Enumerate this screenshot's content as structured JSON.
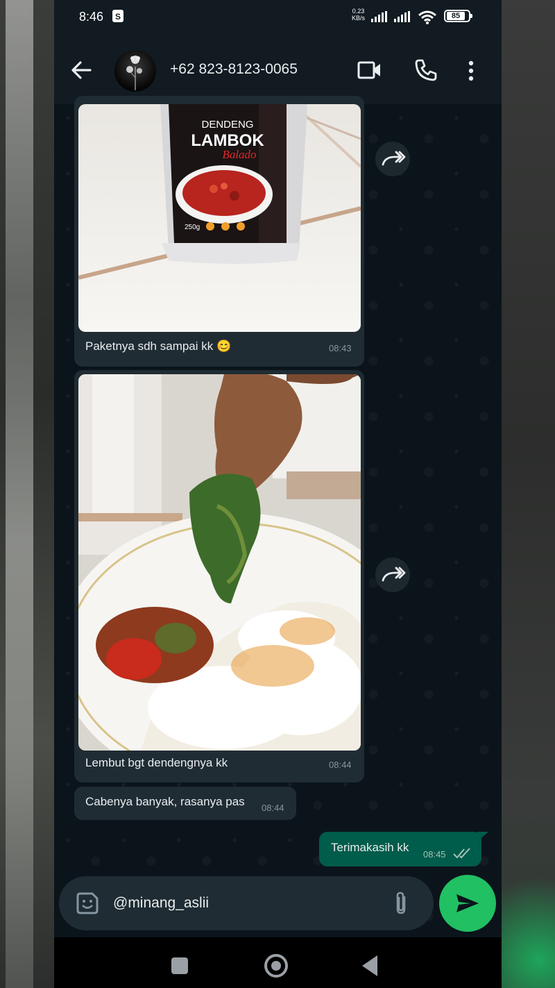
{
  "status_bar": {
    "time": "8:46",
    "net_speed_value": "0.23",
    "net_speed_unit": "KB/s",
    "battery": "85"
  },
  "header": {
    "contact": "+62 823-8123-0065",
    "icons": [
      "back-arrow-icon",
      "video-call-icon",
      "phone-icon",
      "more-icon"
    ]
  },
  "messages": [
    {
      "type": "image",
      "direction": "incoming",
      "package_brand_top": "DENDENG",
      "package_brand_main": "LAMBOK",
      "package_brand_sub": "Balado",
      "package_weight": "250g",
      "caption": "Paketnya sdh sampai kk 😊",
      "time": "08:43"
    },
    {
      "type": "image",
      "direction": "incoming",
      "caption": "Lembut bgt dendengnya kk",
      "time": "08:44"
    },
    {
      "type": "text",
      "direction": "incoming",
      "text": "Cabenya banyak, rasanya pas",
      "time": "08:44"
    },
    {
      "type": "text",
      "direction": "outgoing",
      "text": "Terimakasih kk",
      "time": "08:45",
      "status": "read"
    }
  ],
  "composer": {
    "value": "@minang_aslii"
  },
  "colors": {
    "incoming_bubble": "#202c33",
    "outgoing_bubble": "#005c4b",
    "send_button": "#21c063",
    "background": "#0b141a"
  }
}
